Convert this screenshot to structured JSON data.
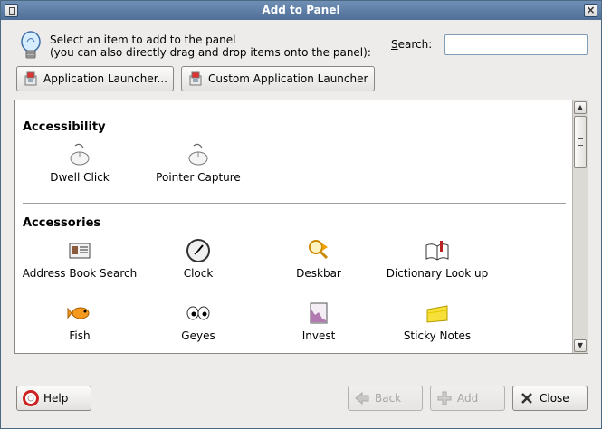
{
  "window": {
    "title": "Add to Panel"
  },
  "header": {
    "instruction_line1": "Select an item to add to the panel",
    "instruction_line2": "(you can also directly drag and drop items onto the panel):",
    "search_label": "Search:",
    "search_value": ""
  },
  "launchers": {
    "application_launcher": "Application Launcher...",
    "custom_application_launcher": "Custom Application Launcher"
  },
  "sections": [
    {
      "title": "Accessibility",
      "items": [
        {
          "label": "Dwell Click",
          "icon": "mouse-icon"
        },
        {
          "label": "Pointer Capture",
          "icon": "mouse-icon"
        }
      ]
    },
    {
      "title": "Accessories",
      "items": [
        {
          "label": "Address Book Search",
          "icon": "address-card-icon"
        },
        {
          "label": "Clock",
          "icon": "clock-icon"
        },
        {
          "label": "Deskbar",
          "icon": "magnifier-icon"
        },
        {
          "label": "Dictionary Look up",
          "icon": "book-icon"
        },
        {
          "label": "Fish",
          "icon": "fish-icon"
        },
        {
          "label": "Geyes",
          "icon": "eyes-icon"
        },
        {
          "label": "Invest",
          "icon": "chart-icon"
        },
        {
          "label": "Sticky Notes",
          "icon": "sticky-note-icon"
        }
      ]
    }
  ],
  "footer": {
    "help": "Help",
    "back": "Back",
    "add": "Add",
    "close": "Close"
  }
}
